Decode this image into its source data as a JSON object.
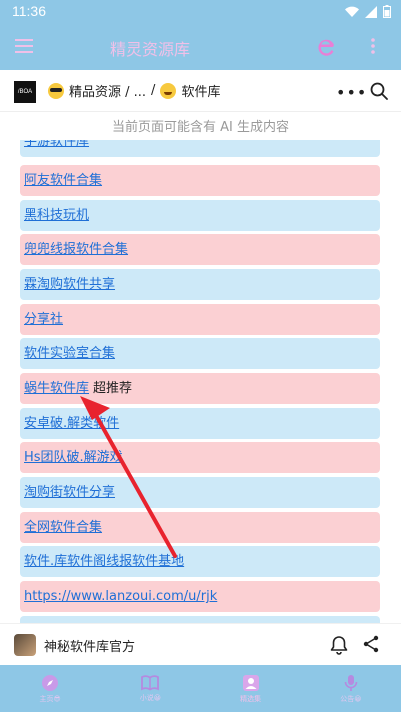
{
  "status_bar": {
    "time": "11:36"
  },
  "app_bar": {
    "title": "精灵资源库"
  },
  "web_header": {
    "logo_text": "/BOA",
    "crumb1": "精品资源 / ...",
    "separator": "/",
    "crumb2": "软件库"
  },
  "ai_notice": "当前页面可能含有 AI 生成内容",
  "list": {
    "items": [
      {
        "label": "手游软件库",
        "suffix": "",
        "color": "blue"
      },
      {
        "label": "阿友软件合集",
        "suffix": "",
        "color": "pink"
      },
      {
        "label": "黑科技玩机",
        "suffix": "",
        "color": "blue"
      },
      {
        "label": "兜兜线报软件合集",
        "suffix": "",
        "color": "pink"
      },
      {
        "label": "霖淘购软件共享",
        "suffix": "",
        "color": "blue"
      },
      {
        "label": "分享社",
        "suffix": "",
        "color": "pink"
      },
      {
        "label": "软件实验室合集",
        "suffix": "",
        "color": "blue"
      },
      {
        "label": "蜗牛软件库",
        "suffix": "超推荐",
        "color": "pink"
      },
      {
        "label": "安卓破.解类软件",
        "suffix": "",
        "color": "blue"
      },
      {
        "label": "Hs团队破.解游戏",
        "suffix": "",
        "color": "pink"
      },
      {
        "label": "淘购街软件分享",
        "suffix": "",
        "color": "blue"
      },
      {
        "label": "全网软件合集",
        "suffix": "",
        "color": "pink"
      },
      {
        "label": "软件.库软件阁线报软件基地",
        "suffix": "",
        "color": "blue"
      },
      {
        "label": "https://www.lanzoui.com/u/rjk",
        "suffix": "",
        "color": "pink"
      },
      {
        "label": "",
        "suffix": "",
        "color": "blue"
      }
    ]
  },
  "author_bar": {
    "name": "神秘软件库官方"
  },
  "bottom_nav": {
    "items": [
      {
        "label": "主页😎",
        "icon": "compass-icon"
      },
      {
        "label": "小说😀",
        "icon": "book-icon"
      },
      {
        "label": "精选集",
        "icon": "profile-icon"
      },
      {
        "label": "公告😀",
        "icon": "microphone-icon"
      }
    ]
  },
  "colors": {
    "bar": "#8ec7e6",
    "row_blue": "#cde9f8",
    "row_pink": "#fbd0d3",
    "link": "#1f6fd6",
    "arrow": "#e8232e"
  }
}
